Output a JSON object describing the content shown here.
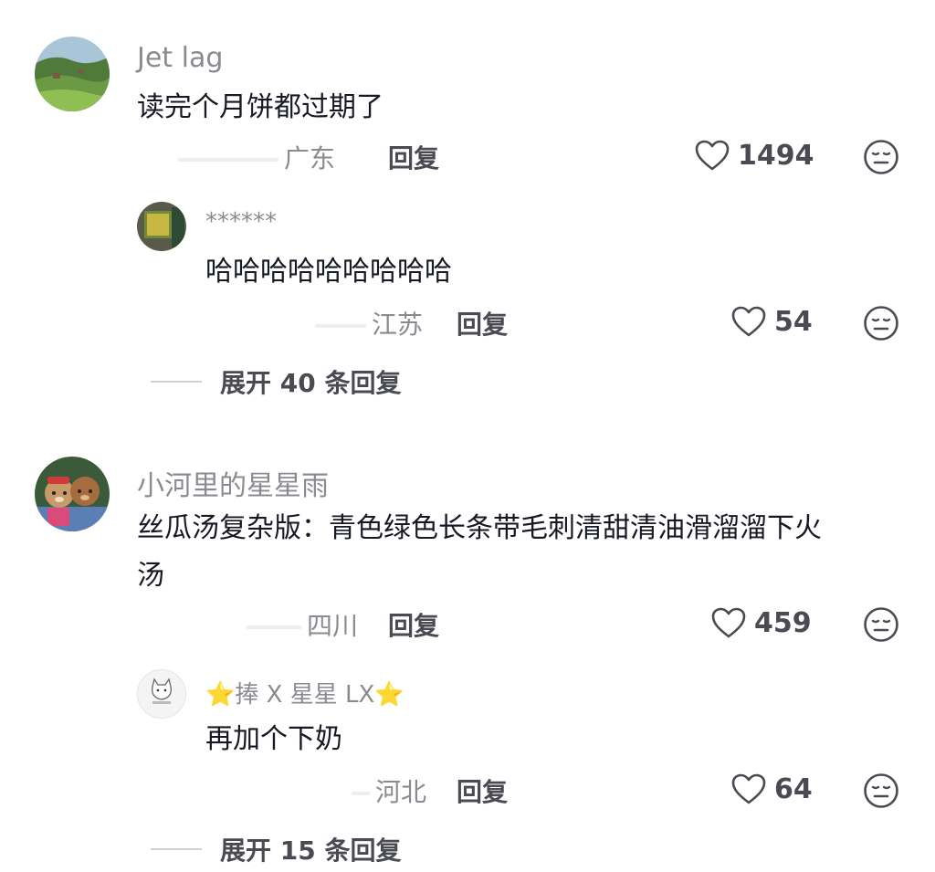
{
  "comments": [
    {
      "username": "Jet lag",
      "text": "读完个月饼都过期了",
      "location": "广东",
      "reply_label": "回复",
      "likes": "1494",
      "avatar": "landscape-avatar",
      "replies": [
        {
          "username": "******",
          "text": "哈哈哈哈哈哈哈哈哈",
          "location": "江苏",
          "reply_label": "回复",
          "likes": "54",
          "avatar": "painting-avatar"
        }
      ],
      "expand_label": "展开 40 条回复"
    },
    {
      "username": "小河里的星星雨",
      "text_line1": "丝瓜汤复杂版：青色绿色长条带毛刺清甜清油滑溜溜下火",
      "text_line2": "汤",
      "location": "四川",
      "reply_label": "回复",
      "likes": "459",
      "avatar": "bears-avatar",
      "replies": [
        {
          "username": "⭐捧 X 星星 LX⭐",
          "text": "再加个下奶",
          "location": "河北",
          "reply_label": "回复",
          "likes": "64",
          "avatar": "cat-avatar"
        }
      ],
      "expand_label": "展开 15 条回复"
    }
  ],
  "icons": {
    "like": "heart-outline-icon",
    "dislike": "neutral-face-icon"
  }
}
